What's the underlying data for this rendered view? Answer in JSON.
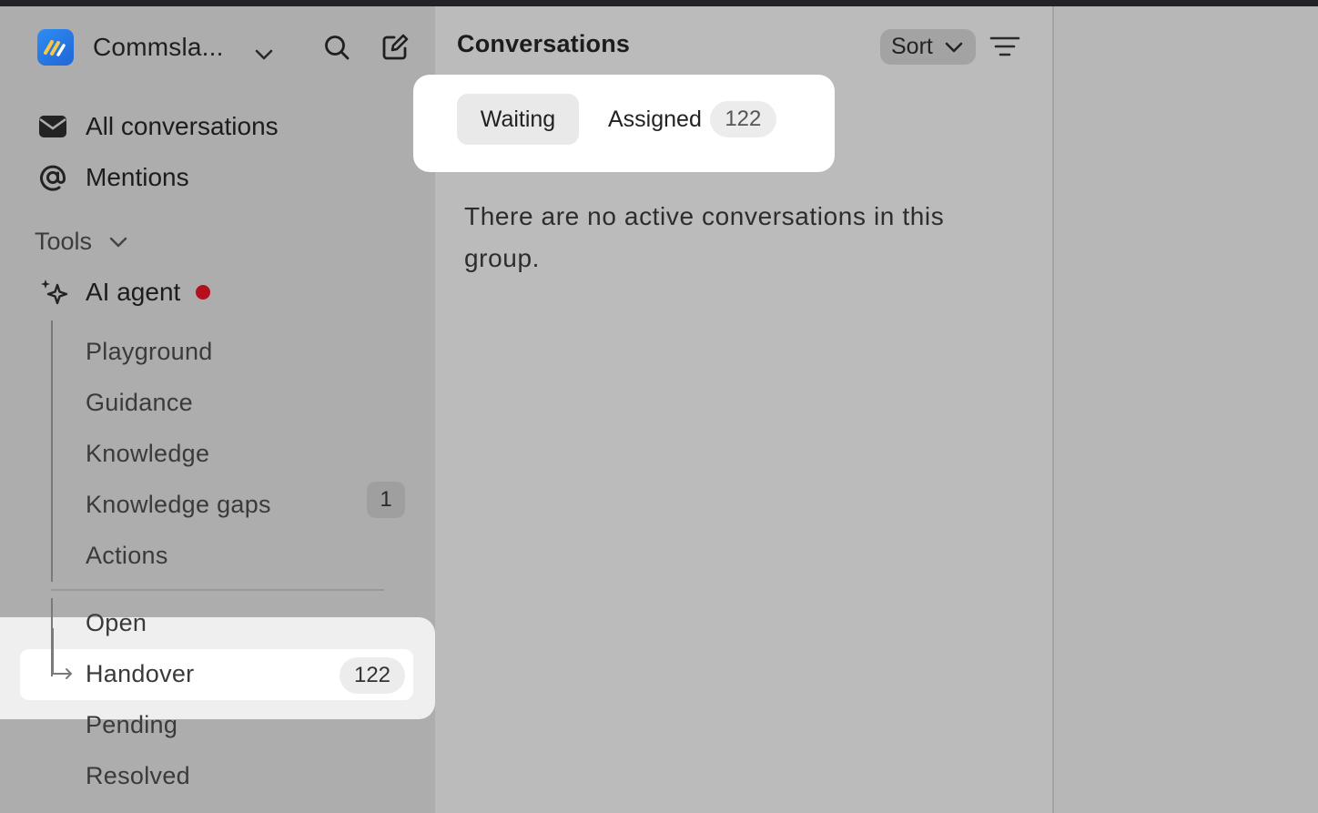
{
  "workspace": {
    "name": "Commsla..."
  },
  "nav": {
    "all_conversations": "All conversations",
    "mentions": "Mentions"
  },
  "tools": {
    "label": "Tools",
    "ai_agent": {
      "label": "AI agent",
      "status_color": "#b30f1c"
    },
    "sub_items": [
      {
        "label": "Playground"
      },
      {
        "label": "Guidance"
      },
      {
        "label": "Knowledge"
      },
      {
        "label": "Knowledge gaps",
        "count": "1"
      },
      {
        "label": "Actions"
      }
    ],
    "status_items": [
      {
        "label": "Open"
      },
      {
        "label": "Handover",
        "count": "122"
      },
      {
        "label": "Pending"
      },
      {
        "label": "Resolved"
      }
    ]
  },
  "main": {
    "title": "Conversations",
    "sort_label": "Sort",
    "tabs": [
      {
        "label": "Waiting"
      },
      {
        "label": "Assigned",
        "count": "122"
      }
    ],
    "empty_message": "There are no active conversations in this group."
  }
}
